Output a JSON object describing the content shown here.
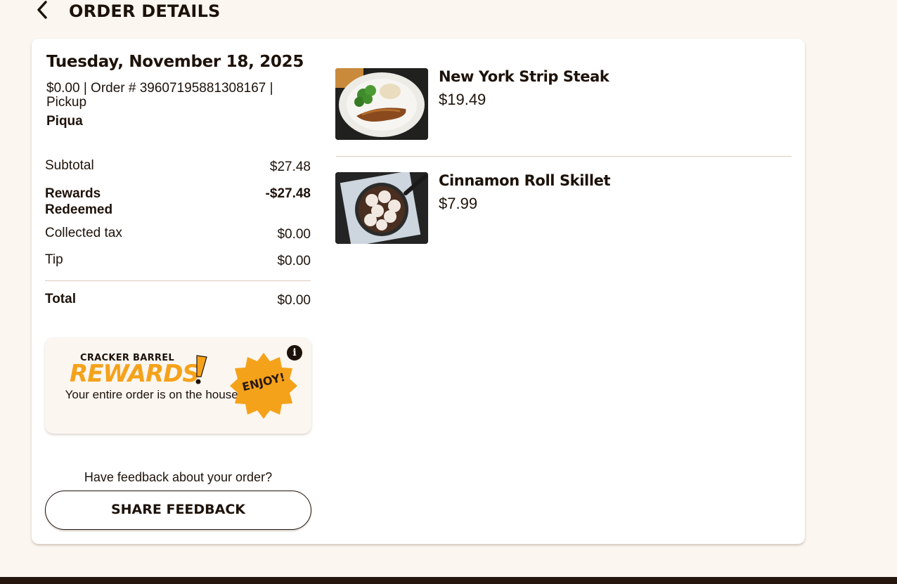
{
  "header": {
    "title": "ORDER DETAILS",
    "back_icon": "chevron-left-icon"
  },
  "order": {
    "date": "Tuesday, November 18, 2025",
    "meta": "$0.00 | Order # 39607195881308167 | Pickup",
    "location": "Piqua"
  },
  "summary": {
    "subtotal_label": "Subtotal",
    "subtotal_value": "$27.48",
    "rewards_label": "Rewards Redeemed",
    "rewards_value": "-$27.48",
    "tax_label": "Collected tax",
    "tax_value": "$0.00",
    "tip_label": "Tip",
    "tip_value": "$0.00",
    "total_label": "Total",
    "total_value": "$0.00"
  },
  "rewards": {
    "brand_small": "CRACKER BARREL",
    "brand_big": "REWARDS",
    "message": "Your entire order is on the house!",
    "badge": "ENJOY!",
    "info_icon": "info-icon",
    "info_glyph": "i",
    "accent_color": "#f5a21b"
  },
  "feedback": {
    "question": "Have feedback about your order?",
    "button_label": "SHARE FEEDBACK"
  },
  "items": [
    {
      "name": "New York Strip Steak",
      "price": "$19.49",
      "image": "steak-plate-image"
    },
    {
      "name": "Cinnamon Roll Skillet",
      "price": "$7.99",
      "image": "cinnamon-roll-skillet-image"
    }
  ],
  "colors": {
    "page_bg": "#fbf6f0",
    "text": "#1d120a",
    "footer": "#25170d"
  }
}
